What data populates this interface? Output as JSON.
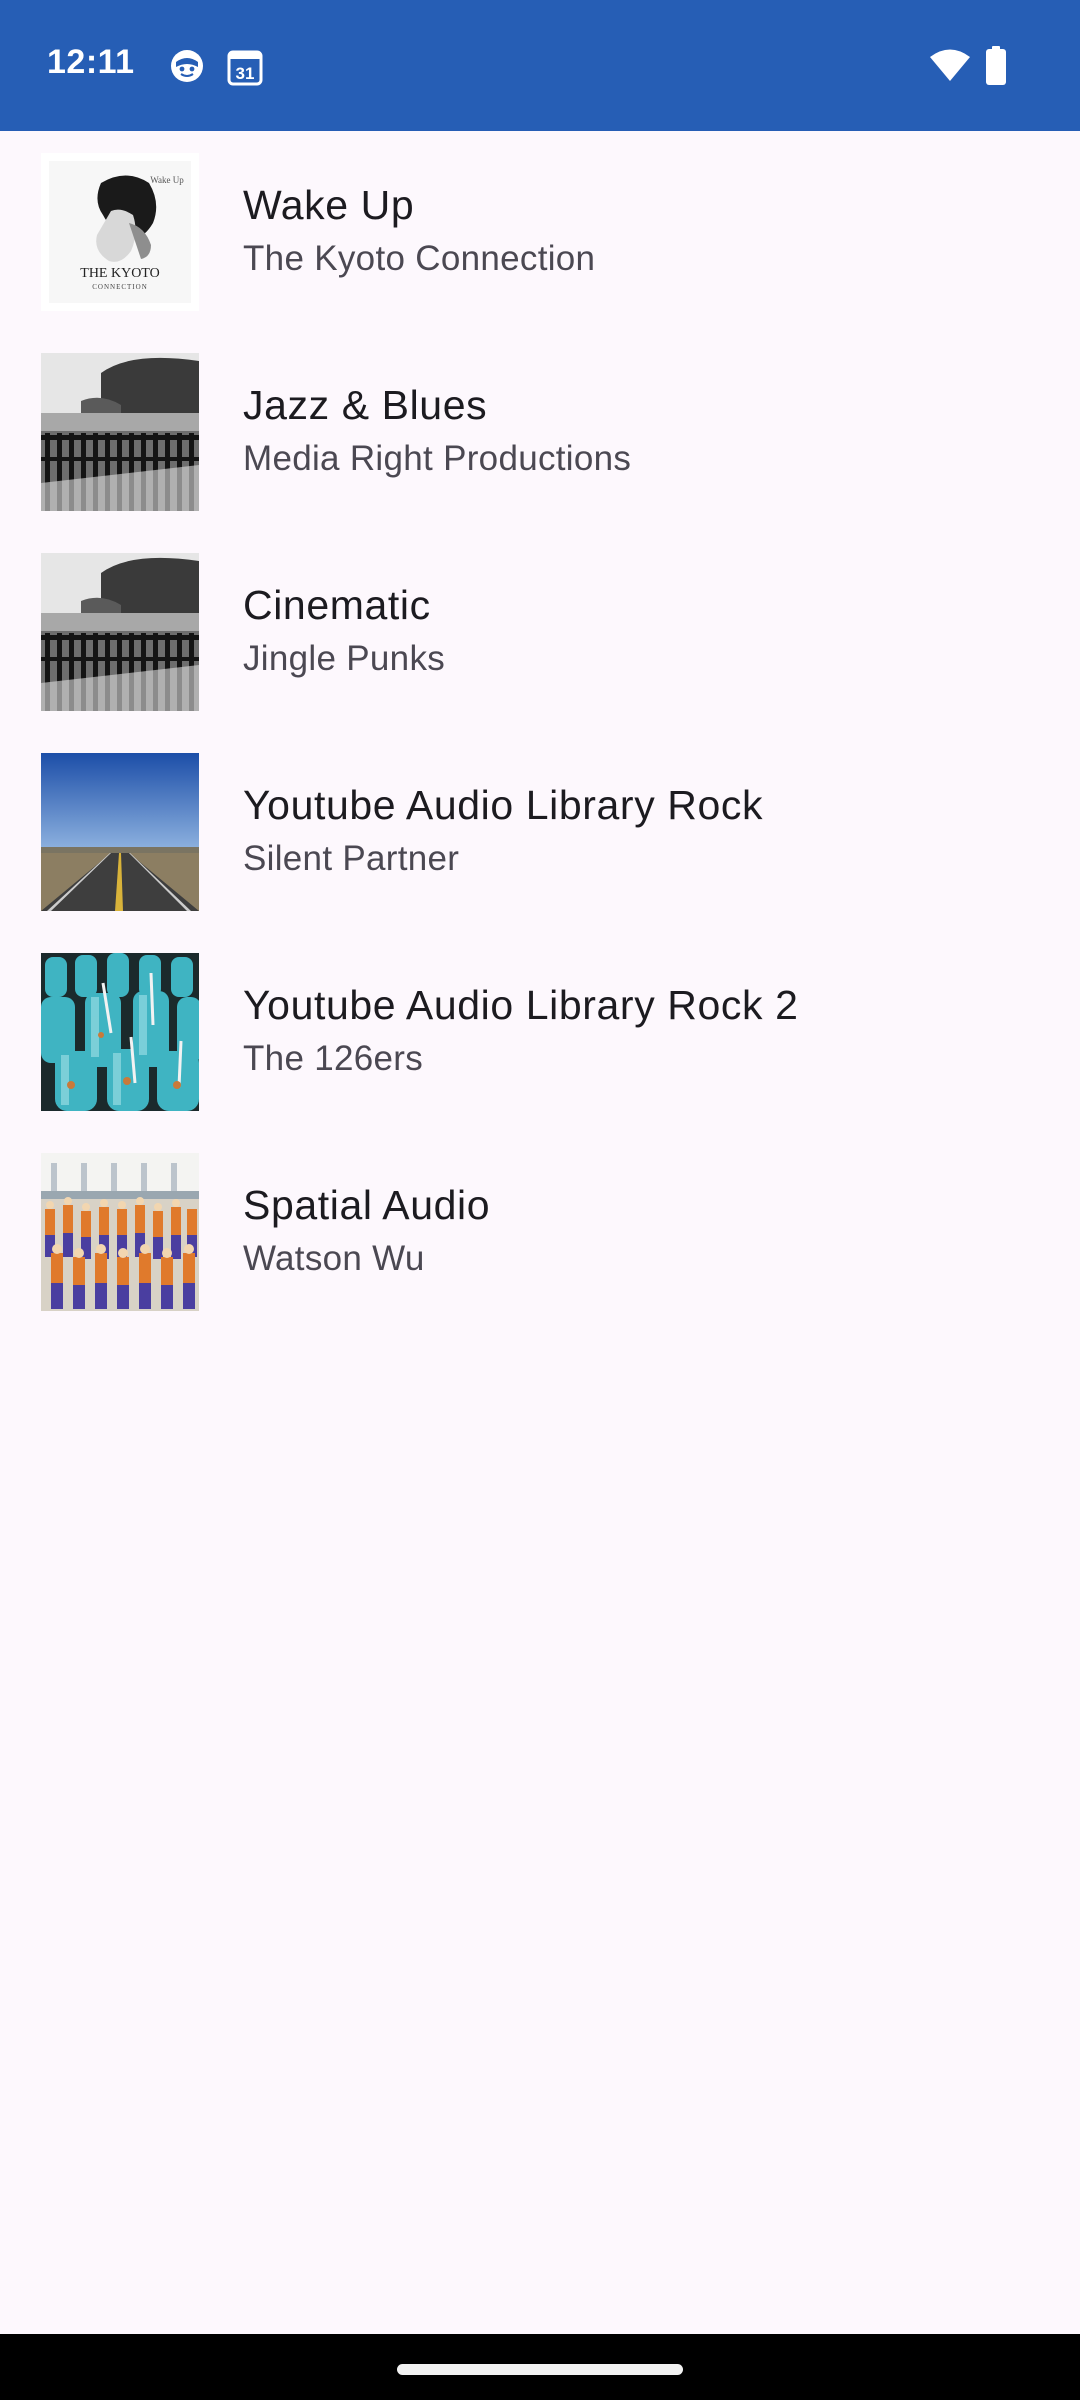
{
  "status_bar": {
    "time": "12:11",
    "background_color": "#265eb5",
    "calendar_date": "31",
    "icons": [
      "face-notification-icon",
      "calendar-icon",
      "wifi-icon",
      "battery-icon"
    ]
  },
  "tracks": [
    {
      "title": "Wake Up",
      "artist": "The Kyoto Connection",
      "art_icon": "album-art-kyoto",
      "art_text_line1": "THE KYOTO",
      "art_text_line2": "CONNECTION",
      "art_text_corner": "Wake Up"
    },
    {
      "title": "Jazz & Blues",
      "artist": "Media Right Productions",
      "art_icon": "album-art-coast-fence"
    },
    {
      "title": "Cinematic",
      "artist": "Jingle Punks",
      "art_icon": "album-art-coast-fence"
    },
    {
      "title": "Youtube Audio Library Rock",
      "artist": "Silent Partner",
      "art_icon": "album-art-desert-road"
    },
    {
      "title": "Youtube Audio Library Rock 2",
      "artist": "The 126ers",
      "art_icon": "album-art-blue-bottles"
    },
    {
      "title": "Spatial Audio",
      "artist": "Watson Wu",
      "art_icon": "album-art-marching-band"
    }
  ]
}
